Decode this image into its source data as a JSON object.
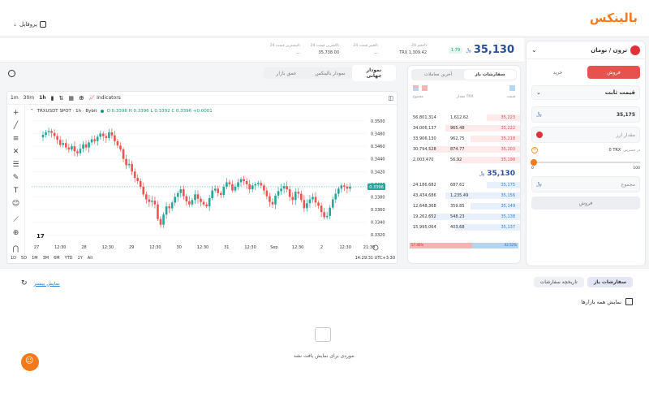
{
  "brand": "بالینکس",
  "profile": "پروفایل",
  "market": {
    "pair": "ترون / تومان",
    "price": "35,130",
    "change": "1.79",
    "stats": [
      {
        "label": "حجم 24h",
        "value": "TRX 1,309.42"
      },
      {
        "label": "تغییر قیمت 24h",
        "value": "..."
      },
      {
        "label": "کمترین قیمت 24h",
        "value": "35,738.00"
      },
      {
        "label": "بیشترین قیمت 24h",
        "value": "..."
      }
    ]
  },
  "chart_tabs": [
    "نمودار جهانی",
    "نمودار بالینکس",
    "عمق بازار"
  ],
  "chart": {
    "symbol": "TRXUSDT SPOT · 1h · Bybit",
    "ohlc": "O 0.3396  H 0.3396  L 0.3392  C 0.3396  +0.0001",
    "intervals": [
      "1m",
      "30m",
      "1h"
    ],
    "indicators": "Indicators",
    "ranges": [
      "1D",
      "5D",
      "1M",
      "3M",
      "6M",
      "YTD",
      "1Y",
      "All"
    ],
    "clock": "14:29:31 UTC+3:30",
    "price_label": "0.3396",
    "yticks": [
      "0.3500",
      "0.3480",
      "0.3460",
      "0.3440",
      "0.3420",
      "0.3400",
      "0.3380",
      "0.3360",
      "0.3340",
      "0.3320"
    ],
    "xticks": [
      "27",
      "12:30",
      "28",
      "12:30",
      "29",
      "12:30",
      "30",
      "12:30",
      "31",
      "12:30",
      "Sep",
      "12:30",
      "2",
      "12:30",
      "21:30"
    ]
  },
  "chart_data": {
    "type": "candlestick",
    "y_range": [
      0.331,
      0.3505
    ],
    "closes": [
      0.3478,
      0.3482,
      0.3484,
      0.3481,
      0.3476,
      0.347,
      0.3462,
      0.3465,
      0.3458,
      0.3455,
      0.346,
      0.3452,
      0.3449,
      0.3456,
      0.3463,
      0.3458,
      0.3466,
      0.3471,
      0.3468,
      0.3475,
      0.348,
      0.3476,
      0.3473,
      0.3482,
      0.3477,
      0.3468,
      0.3461,
      0.3455,
      0.344,
      0.343,
      0.3432,
      0.342,
      0.341,
      0.3405,
      0.3396,
      0.3384,
      0.3376,
      0.3372,
      0.3374,
      0.3368,
      0.3345,
      0.3336,
      0.3352,
      0.3365,
      0.3362,
      0.3371,
      0.338,
      0.3386,
      0.3392,
      0.3381,
      0.3373,
      0.3368,
      0.3375,
      0.3384,
      0.3377,
      0.3372,
      0.3368,
      0.3365,
      0.3378,
      0.339,
      0.3393,
      0.3386,
      0.3383,
      0.3396,
      0.3403,
      0.34,
      0.339,
      0.3396,
      0.3403,
      0.3408,
      0.3405,
      0.34,
      0.3392,
      0.3398,
      0.34,
      0.3402,
      0.3398,
      0.339,
      0.3381,
      0.3372,
      0.3368,
      0.3382,
      0.3389,
      0.3393,
      0.3397,
      0.3392,
      0.338,
      0.3375,
      0.3388,
      0.3385,
      0.3375,
      0.3362,
      0.337,
      0.3376,
      0.338,
      0.3371,
      0.3366,
      0.3356,
      0.3348,
      0.335,
      0.3363,
      0.3376,
      0.3385,
      0.3393,
      0.3398,
      0.3396,
      0.3393,
      0.3396
    ]
  },
  "orderbook_tabs": [
    "سفارشات باز",
    "آخرین معاملات"
  ],
  "orderbook_headers": [
    "قیمت",
    "مقدار TRX",
    "مجموع"
  ],
  "asks": [
    {
      "price": "35,223",
      "amount": "1,612.62",
      "total": "56,801,314"
    },
    {
      "price": "35,222",
      "amount": "965.48",
      "total": "34,006,137"
    },
    {
      "price": "35,218",
      "amount": "962.75",
      "total": "33,906,130"
    },
    {
      "price": "35,203",
      "amount": "874.77",
      "total": "30,794,528"
    },
    {
      "price": "35,198",
      "amount": "56.92",
      "total": "2,003,470"
    }
  ],
  "mid_price": "35,130",
  "bids": [
    {
      "price": "35,175",
      "amount": "687.61",
      "total": "24,186,682"
    },
    {
      "price": "35,156",
      "amount": "1,235.49",
      "total": "43,434,686"
    },
    {
      "price": "35,149",
      "amount": "359.85",
      "total": "12,648,368"
    },
    {
      "price": "35,138",
      "amount": "548.23",
      "total": "19,262,652"
    },
    {
      "price": "35,137",
      "amount": "403.68",
      "total": "15,995,064"
    }
  ],
  "depth_bar": {
    "sell_pct": "57.46%",
    "buy_pct": "42.52%",
    "sell_fraction": 0.5746
  },
  "trade": {
    "buy": "خرید",
    "sell": "فروش",
    "order_type": "قیمت ثابت",
    "price_value": "35,175",
    "amount_placeholder": "مقدار ارز",
    "balance_label": "در دسترس",
    "balance_value": "0 TRX",
    "slider_min": "0",
    "slider_max": "100",
    "total_placeholder": "مجموع",
    "submit": "فروش"
  },
  "orders": {
    "tabs": [
      "سفارشات باز",
      "تاریخچه سفارشات"
    ],
    "show_all": "نمایش همه بازارها",
    "show_more": "نمایش بیشتر",
    "empty": "موردی برای نمایش یافت نشد."
  }
}
